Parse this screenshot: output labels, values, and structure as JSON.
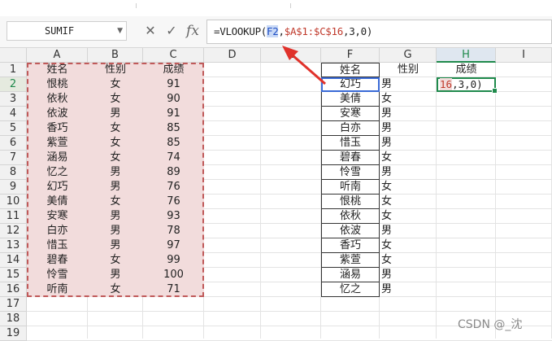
{
  "formula_bar": {
    "name_box": "SUMIF",
    "cancel_icon": "✕",
    "enter_icon": "✓",
    "fx_label": "fx",
    "formula_prefix": "=VLOOKUP(",
    "formula_ref1": "F2",
    "formula_mid": ",",
    "formula_ref2": "$A$1:$C$16",
    "formula_suffix": ",3,0)"
  },
  "columns": [
    "A",
    "B",
    "C",
    "D",
    "E",
    "F",
    "G",
    "H",
    "I"
  ],
  "rows": [
    "1",
    "2",
    "3",
    "4",
    "5",
    "6",
    "7",
    "8",
    "9",
    "10",
    "11",
    "12",
    "13",
    "14",
    "15",
    "16",
    "17",
    "18",
    "19"
  ],
  "selected": {
    "column": "H",
    "row": "2"
  },
  "table1": {
    "headers": [
      "姓名",
      "性别",
      "成绩"
    ],
    "rows": [
      [
        "恨桃",
        "女",
        "91"
      ],
      [
        "依秋",
        "女",
        "90"
      ],
      [
        "依波",
        "男",
        "91"
      ],
      [
        "香巧",
        "女",
        "85"
      ],
      [
        "紫萱",
        "女",
        "85"
      ],
      [
        "涵易",
        "女",
        "74"
      ],
      [
        "忆之",
        "男",
        "89"
      ],
      [
        "幻巧",
        "男",
        "76"
      ],
      [
        "美倩",
        "女",
        "76"
      ],
      [
        "安寒",
        "男",
        "93"
      ],
      [
        "白亦",
        "男",
        "78"
      ],
      [
        "惜玉",
        "男",
        "97"
      ],
      [
        "碧春",
        "女",
        "99"
      ],
      [
        "怜雪",
        "男",
        "100"
      ],
      [
        "听南",
        "女",
        "71"
      ]
    ]
  },
  "table2": {
    "headers": [
      "姓名",
      "性别",
      "成绩"
    ],
    "names": [
      "幻巧",
      "美倩",
      "安寒",
      "白亦",
      "惜玉",
      "碧春",
      "怜雪",
      "听南",
      "恨桃",
      "依秋",
      "依波",
      "香巧",
      "紫萱",
      "涵易",
      "忆之"
    ],
    "genders": [
      "男",
      "女",
      "男",
      "男",
      "男",
      "女",
      "男",
      "女",
      "女",
      "女",
      "男",
      "女",
      "女",
      "男",
      "男"
    ]
  },
  "editing_cell": {
    "ref_part": "16",
    "rest": ",3,0)"
  },
  "watermark": "CSDN @_沈",
  "colors": {
    "accent": "#1f8a4c",
    "ref_blue": "#3a6ad6",
    "ref_red": "#c0392b",
    "range_fill": "#f2dcdc",
    "arrow": "#e0322b"
  }
}
